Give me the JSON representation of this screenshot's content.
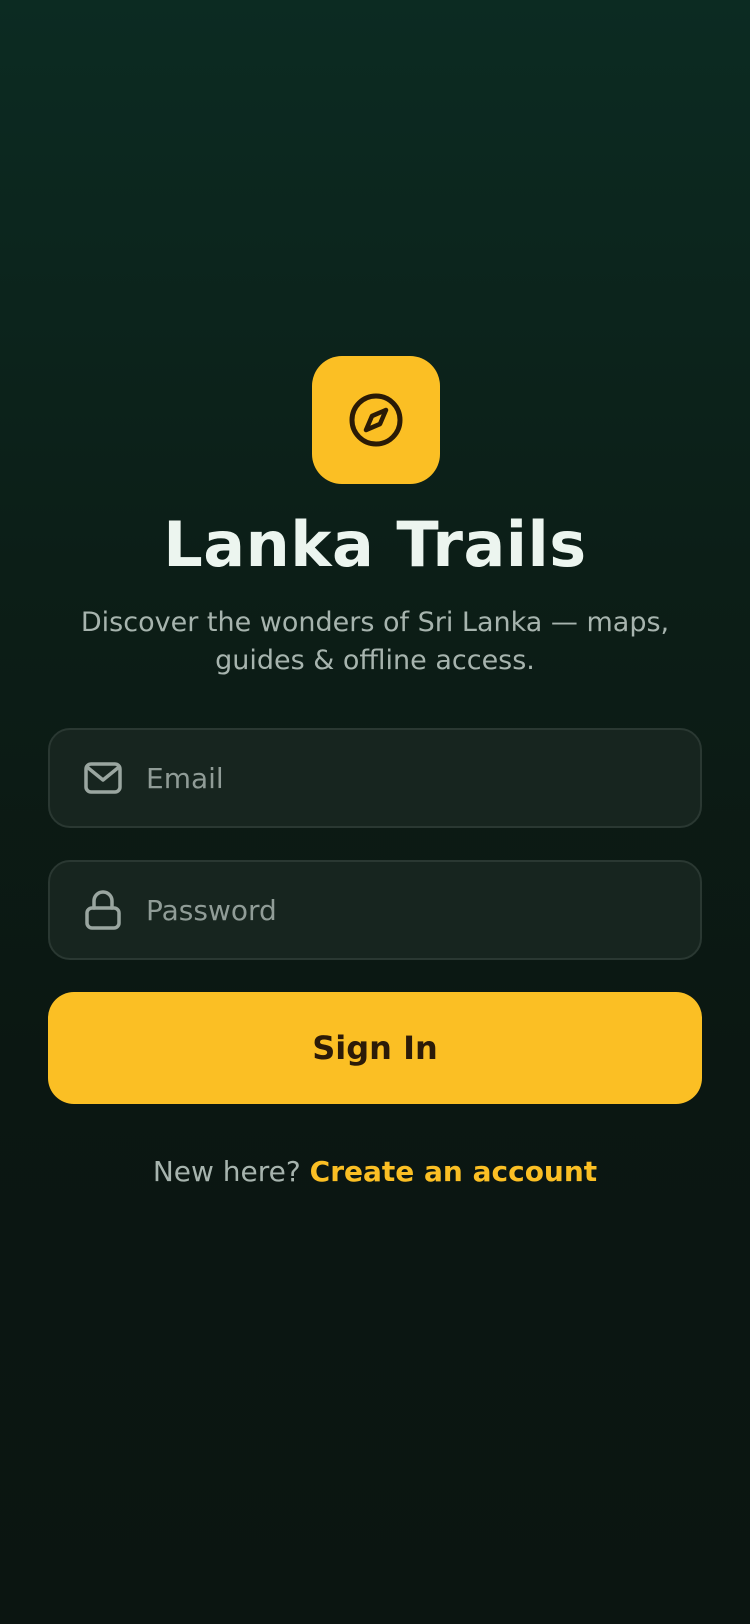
{
  "brand": {
    "icon": "compass-icon",
    "accent_color": "#fbbf24",
    "title": "Lanka Trails",
    "tagline_line1": "Discover the wonders of Sri Lanka — maps,",
    "tagline_line2": "guides & offline access."
  },
  "form": {
    "email": {
      "icon": "mail-icon",
      "placeholder": "Email",
      "value": ""
    },
    "password": {
      "icon": "lock-icon",
      "placeholder": "Password",
      "value": ""
    },
    "submit_label": "Sign In"
  },
  "footer": {
    "prompt": "New here?",
    "link_label": "Create an account"
  }
}
